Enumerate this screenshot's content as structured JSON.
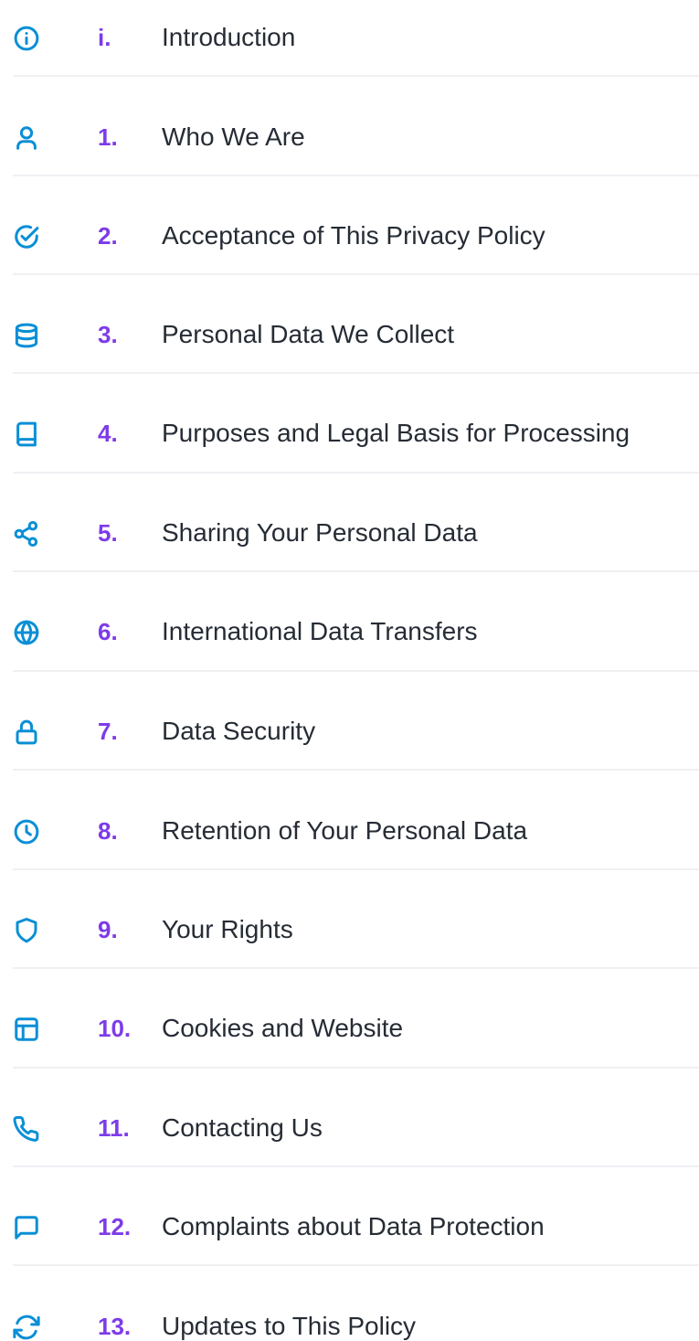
{
  "colors": {
    "icon": "#0a8fd6",
    "number": "#7d3be9",
    "label": "#262c35",
    "divider": "#eef0f3"
  },
  "toc": {
    "items": [
      {
        "num": "i.",
        "label": "Introduction",
        "icon": "info-icon"
      },
      {
        "num": "1.",
        "label": "Who We Are",
        "icon": "user-icon"
      },
      {
        "num": "2.",
        "label": "Acceptance of This Privacy Policy",
        "icon": "check-circle-icon"
      },
      {
        "num": "3.",
        "label": "Personal Data We Collect",
        "icon": "database-icon"
      },
      {
        "num": "4.",
        "label": "Purposes and Legal Basis for Processing",
        "icon": "book-icon"
      },
      {
        "num": "5.",
        "label": "Sharing Your Personal Data",
        "icon": "share-icon"
      },
      {
        "num": "6.",
        "label": "International Data Transfers",
        "icon": "globe-icon"
      },
      {
        "num": "7.",
        "label": "Data Security",
        "icon": "lock-icon"
      },
      {
        "num": "8.",
        "label": "Retention of Your Personal Data",
        "icon": "clock-icon"
      },
      {
        "num": "9.",
        "label": "Your Rights",
        "icon": "shield-icon"
      },
      {
        "num": "10.",
        "label": "Cookies and Website",
        "icon": "layout-icon"
      },
      {
        "num": "11.",
        "label": "Contacting Us",
        "icon": "phone-icon"
      },
      {
        "num": "12.",
        "label": "Complaints about Data Protection",
        "icon": "message-icon"
      },
      {
        "num": "13.",
        "label": "Updates to This Policy",
        "icon": "refresh-icon"
      }
    ]
  }
}
